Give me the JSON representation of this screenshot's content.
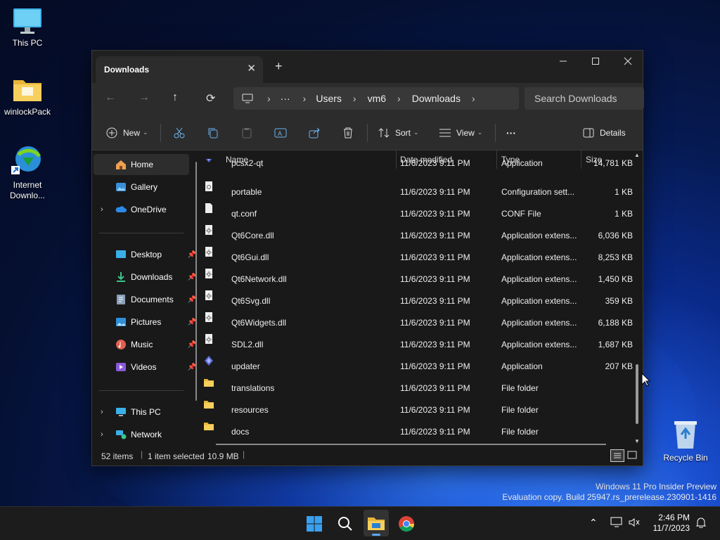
{
  "desktop": {
    "icons": [
      {
        "label": "This PC"
      },
      {
        "label": "winlockPack"
      },
      {
        "label": "Internet Downlo..."
      },
      {
        "label": "Recycle Bin"
      }
    ],
    "watermark": {
      "line1": "Windows 11 Pro Insider Preview",
      "line2": "Evaluation copy. Build 25947.rs_prerelease.230901-1416"
    }
  },
  "window": {
    "tab_title": "Downloads",
    "new_tab": "+",
    "controls": {
      "minimize": "—",
      "maximize": "☐",
      "close": "✕"
    },
    "address": {
      "crumbs": [
        "Users",
        "vm6",
        "Downloads"
      ],
      "ellipsis": "···",
      "search_placeholder": "Search Downloads"
    },
    "commands": {
      "new": "New",
      "sort": "Sort",
      "view": "View",
      "more": "···",
      "details": "Details"
    },
    "sidebar": {
      "items": [
        {
          "label": "Home"
        },
        {
          "label": "Gallery"
        },
        {
          "label": "OneDrive"
        },
        {
          "label": "Desktop"
        },
        {
          "label": "Downloads"
        },
        {
          "label": "Documents"
        },
        {
          "label": "Pictures"
        },
        {
          "label": "Music"
        },
        {
          "label": "Videos"
        },
        {
          "label": "This PC"
        },
        {
          "label": "Network"
        }
      ]
    },
    "columns": {
      "name": "Name",
      "date": "Date modified",
      "type": "Type",
      "size": "Size"
    },
    "files": [
      {
        "name": "pcsx2-qt",
        "date": "11/6/2023 9:11 PM",
        "type": "Application",
        "size": "14,781 KB"
      },
      {
        "name": "portable",
        "date": "11/6/2023 9:11 PM",
        "type": "Configuration sett...",
        "size": "1 KB"
      },
      {
        "name": "qt.conf",
        "date": "11/6/2023 9:11 PM",
        "type": "CONF File",
        "size": "1 KB"
      },
      {
        "name": "Qt6Core.dll",
        "date": "11/6/2023 9:11 PM",
        "type": "Application extens...",
        "size": "6,036 KB"
      },
      {
        "name": "Qt6Gui.dll",
        "date": "11/6/2023 9:11 PM",
        "type": "Application extens...",
        "size": "8,253 KB"
      },
      {
        "name": "Qt6Network.dll",
        "date": "11/6/2023 9:11 PM",
        "type": "Application extens...",
        "size": "1,450 KB"
      },
      {
        "name": "Qt6Svg.dll",
        "date": "11/6/2023 9:11 PM",
        "type": "Application extens...",
        "size": "359 KB"
      },
      {
        "name": "Qt6Widgets.dll",
        "date": "11/6/2023 9:11 PM",
        "type": "Application extens...",
        "size": "6,188 KB"
      },
      {
        "name": "SDL2.dll",
        "date": "11/6/2023 9:11 PM",
        "type": "Application extens...",
        "size": "1,687 KB"
      },
      {
        "name": "updater",
        "date": "11/6/2023 9:11 PM",
        "type": "Application",
        "size": "207 KB"
      },
      {
        "name": "translations",
        "date": "11/6/2023 9:11 PM",
        "type": "File folder",
        "size": ""
      },
      {
        "name": "resources",
        "date": "11/6/2023 9:11 PM",
        "type": "File folder",
        "size": ""
      },
      {
        "name": "docs",
        "date": "11/6/2023 9:11 PM",
        "type": "File folder",
        "size": ""
      }
    ],
    "status": {
      "count": "52 items",
      "selected": "1 item selected",
      "size": "10.9 MB"
    }
  },
  "taskbar": {
    "time": "2:46 PM",
    "date": "11/7/2023",
    "accent": "#0078d4"
  }
}
